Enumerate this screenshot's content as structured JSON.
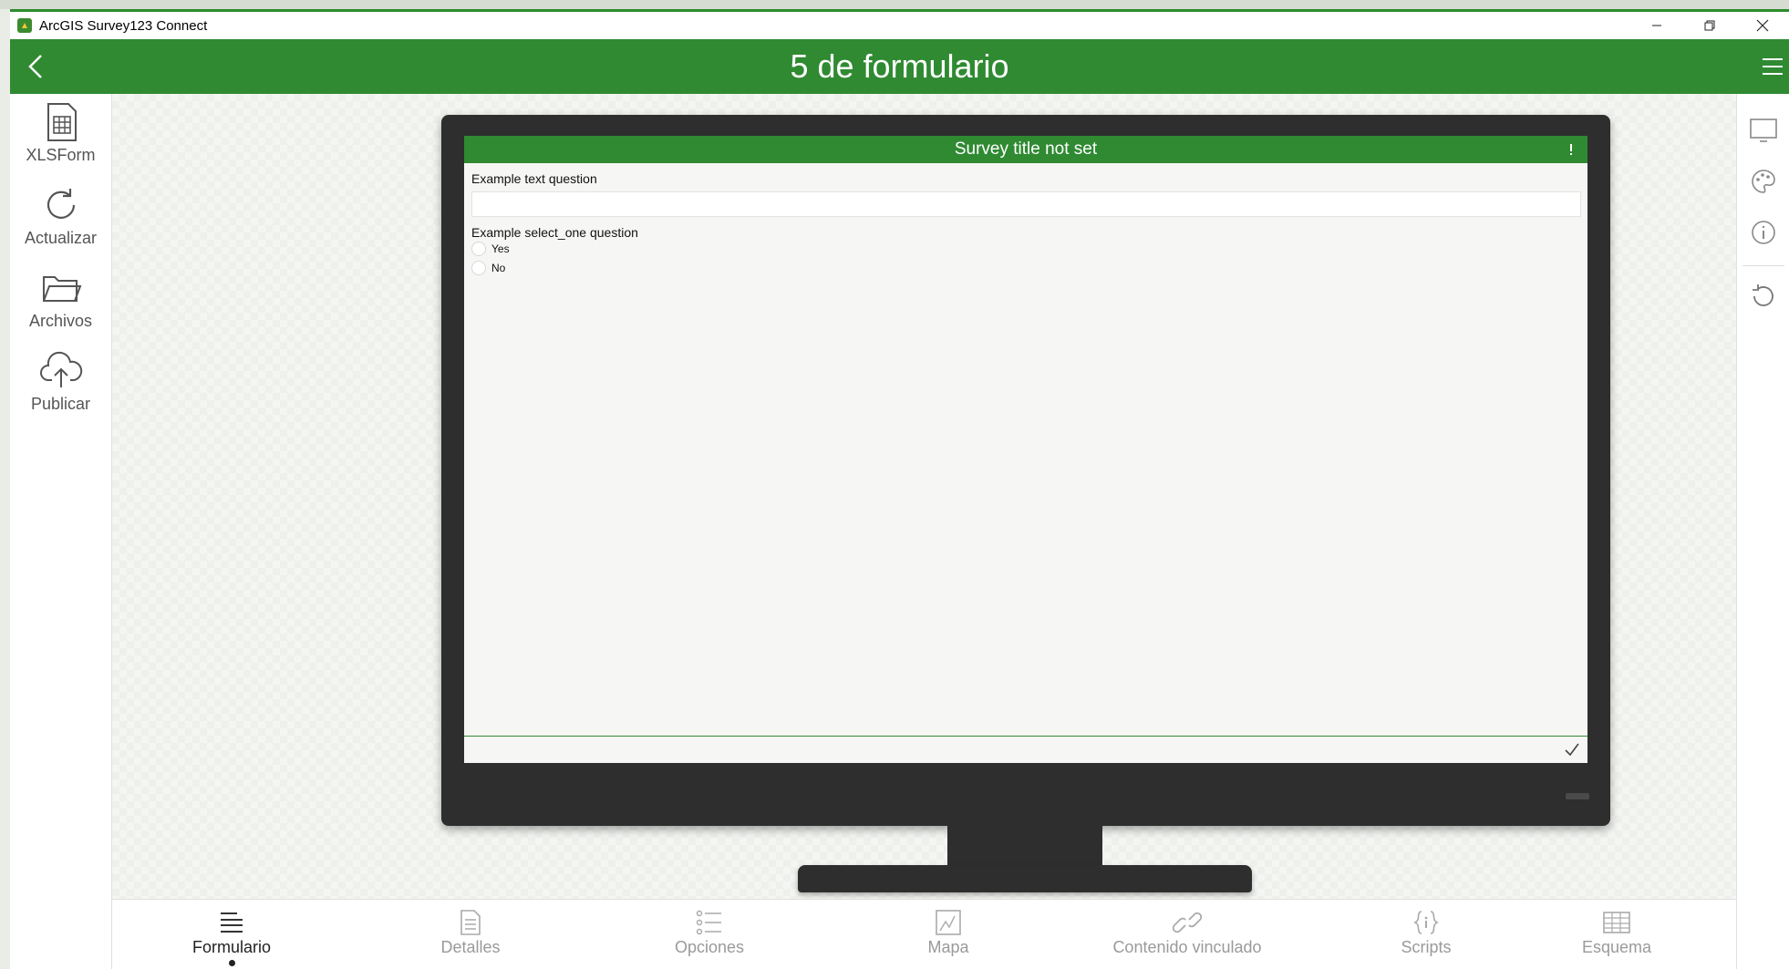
{
  "window": {
    "title": "ArcGIS Survey123 Connect",
    "controls": [
      "minimize-icon",
      "restore-icon",
      "close-icon"
    ]
  },
  "header": {
    "title": "5 de formulario"
  },
  "leftnav": {
    "items": [
      {
        "label": "XLSForm",
        "icon": "spreadsheet-icon"
      },
      {
        "label": "Actualizar",
        "icon": "refresh-icon"
      },
      {
        "label": "Archivos",
        "icon": "folder-icon"
      },
      {
        "label": "Publicar",
        "icon": "cloud-upload-icon"
      }
    ]
  },
  "rightpanel": {
    "items": [
      "monitor-icon",
      "palette-icon",
      "info-icon",
      "reset-icon"
    ]
  },
  "preview": {
    "survey_title": "Survey title not set",
    "questions": {
      "text_question": "Example text question",
      "select_question": "Example select_one question",
      "options": [
        "Yes",
        "No"
      ]
    }
  },
  "bottomtabs": {
    "items": [
      {
        "label": "Formulario",
        "icon": "form-icon",
        "active": true
      },
      {
        "label": "Detalles",
        "icon": "document-icon",
        "active": false
      },
      {
        "label": "Opciones",
        "icon": "list-options-icon",
        "active": false
      },
      {
        "label": "Mapa",
        "icon": "map-icon",
        "active": false
      },
      {
        "label": "Contenido vinculado",
        "icon": "link-icon",
        "active": false
      },
      {
        "label": "Scripts",
        "icon": "braces-icon",
        "active": false
      },
      {
        "label": "Esquema",
        "icon": "table-icon",
        "active": false
      }
    ]
  },
  "colors": {
    "brand_green": "#2f8a32",
    "monitor": "#2e2e2e"
  }
}
